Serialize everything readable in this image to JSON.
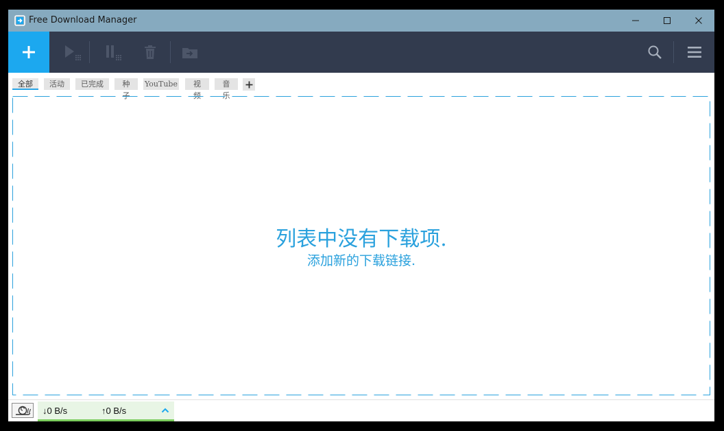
{
  "window": {
    "title": "Free Download Manager",
    "icons": {
      "app": "fdm-logo-icon",
      "minimize": "minimize-icon",
      "maximize": "maximize-icon",
      "close": "close-icon"
    }
  },
  "toolbar": {
    "icons": [
      "plus-icon",
      "play-icon",
      "pause-icon",
      "trash-icon",
      "move-folder-icon",
      "search-icon",
      "menu-icon"
    ],
    "accent_color": "#1ca8ef",
    "background_color": "#323b4e"
  },
  "tabs": {
    "items": [
      {
        "label": "全部",
        "active": true
      },
      {
        "label": "活动",
        "active": false
      },
      {
        "label": "已完成",
        "active": false
      },
      {
        "label": "种子",
        "active": false
      },
      {
        "label": "YouTube",
        "active": false
      },
      {
        "label": "视频",
        "active": false
      },
      {
        "label": "音乐",
        "active": false
      }
    ],
    "add_icon": "plus-icon"
  },
  "main": {
    "empty_title": "列表中没有下载项.",
    "empty_subtitle": "添加新的下载链接.",
    "text_color": "#2aa1dd"
  },
  "status": {
    "download_speed": "↓0 B/s",
    "upload_speed": "↑0 B/s",
    "icons": {
      "snail": "snail-icon",
      "expand": "chevron-up-icon"
    },
    "panel_color": "#7ccd5e"
  }
}
